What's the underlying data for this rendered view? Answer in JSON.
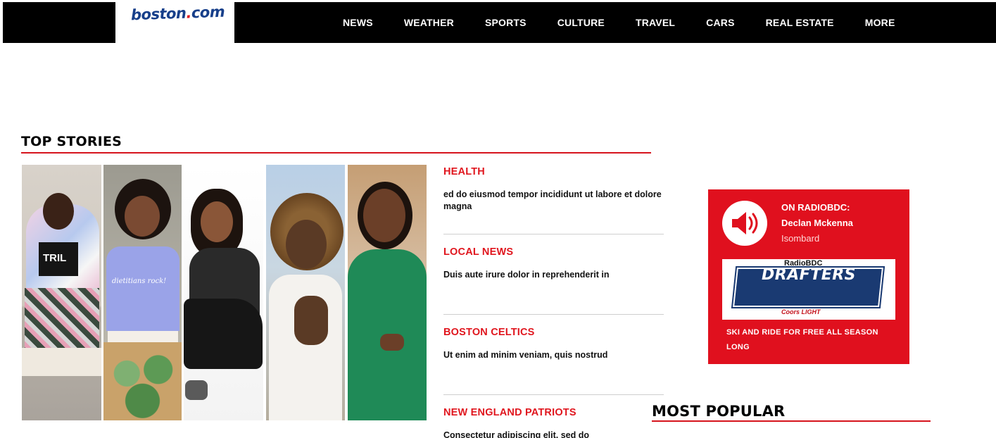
{
  "header": {
    "logo": {
      "main": "boston",
      "dot": ".",
      "tld": "com"
    },
    "nav": [
      "NEWS",
      "WEATHER",
      "SPORTS",
      "CULTURE",
      "TRAVEL",
      "CARS",
      "REAL ESTATE",
      "MORE"
    ]
  },
  "top_stories": {
    "title": "TOP STORIES",
    "shirt_text_1": "TRIL",
    "shirt_text_2": "dietitians rock!",
    "stories": [
      {
        "category": "HEALTH",
        "text": "ed do eiusmod tempor incididunt ut labore et dolore magna"
      },
      {
        "category": "LOCAL NEWS",
        "text": "Duis aute irure dolor in reprehenderit in"
      },
      {
        "category": "BOSTON CELTICS",
        "text": "Ut enim ad minim veniam, quis nostrud"
      },
      {
        "category": "NEW ENGLAND PATRIOTS",
        "text": "Consectetur adipiscing elit, sed do"
      }
    ]
  },
  "ad": {
    "kicker": "ON RADIOBDC:",
    "artist": "Declan Mckenna",
    "song": "Isombard",
    "banner_radio": "RadioBDC",
    "banner_title": "DRAFTERS",
    "banner_sponsor": "Coors LIGHT",
    "cta": "SKI AND RIDE FOR FREE ALL SEASON LONG",
    "icon": "speaker-icon",
    "color": "#e0101e"
  },
  "most_popular": {
    "title": "MOST POPULAR"
  },
  "colors": {
    "accent": "#e0161e",
    "header_bg": "#000000",
    "logo_blue": "#173f8a"
  }
}
